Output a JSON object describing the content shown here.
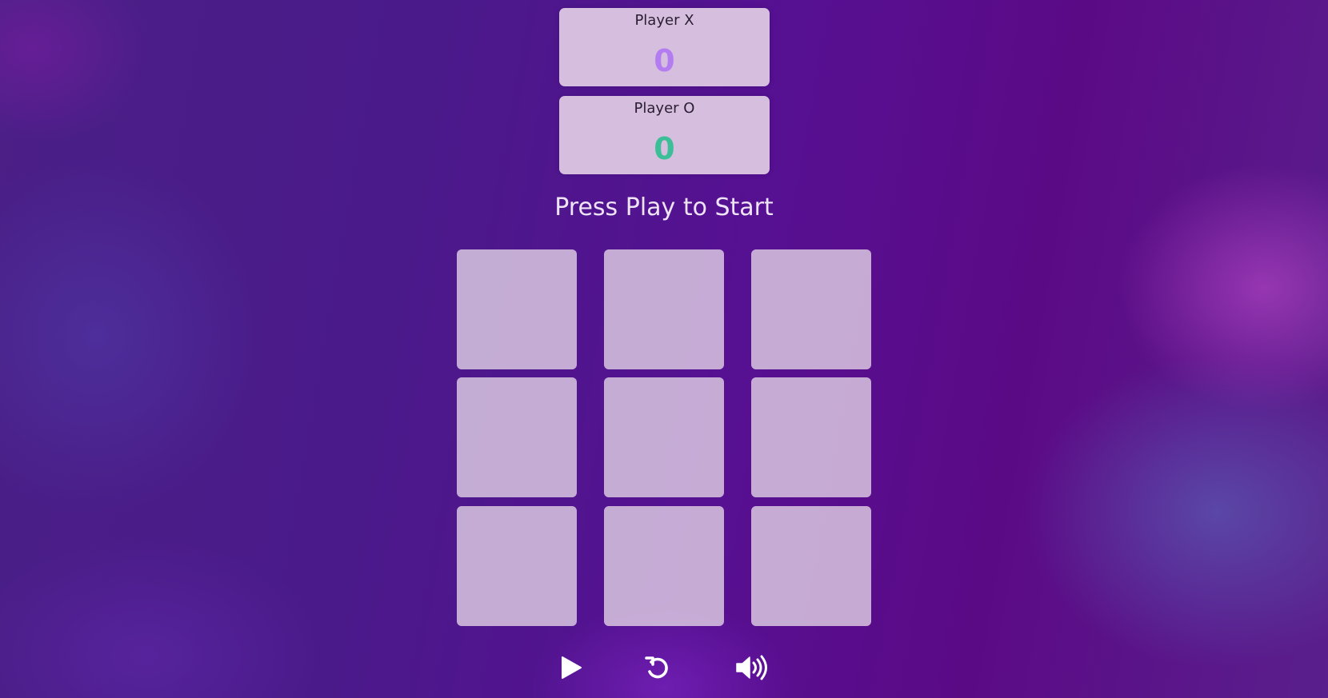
{
  "scoreboard": {
    "player_x": {
      "label": "Player X",
      "score": "0",
      "color": "#b47cf1"
    },
    "player_o": {
      "label": "Player O",
      "score": "0",
      "color": "#3cbf98"
    }
  },
  "status": {
    "message": "Press Play to Start"
  },
  "board": {
    "cells": [
      "",
      "",
      "",
      "",
      "",
      "",
      "",
      "",
      ""
    ]
  },
  "controls": {
    "play": {
      "icon": "play-icon"
    },
    "restart": {
      "icon": "restart-icon"
    },
    "sound": {
      "icon": "volume-icon"
    }
  }
}
